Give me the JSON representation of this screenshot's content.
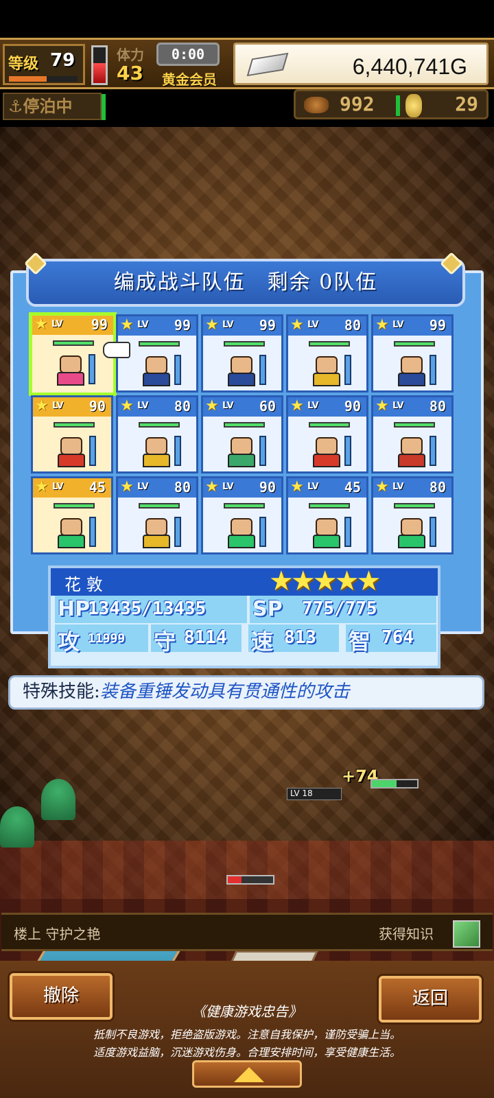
{
  "hud": {
    "level_label": "等级",
    "level": "79",
    "stamina_label": "体力",
    "stamina": "43",
    "timer": "0:00",
    "membership": "黄金会员",
    "gold": "6,440,741G",
    "dock_status": "停泊中",
    "resource_1": "992",
    "resource_2": "29"
  },
  "panel": {
    "title": "编成战斗队伍　剩余 0队伍",
    "lv_label": "LV",
    "cards": [
      {
        "lv": "99",
        "hdr": "gold",
        "body": "#e84a8a"
      },
      {
        "lv": "99",
        "hdr": "blue",
        "body": "#2a4a9a"
      },
      {
        "lv": "99",
        "hdr": "blue",
        "body": "#2a4a9a"
      },
      {
        "lv": "80",
        "hdr": "blue",
        "body": "#e6b82a"
      },
      {
        "lv": "99",
        "hdr": "blue",
        "body": "#2a4a9a"
      },
      {
        "lv": "90",
        "hdr": "gold",
        "body": "#d83a2a"
      },
      {
        "lv": "80",
        "hdr": "blue",
        "body": "#e6b82a"
      },
      {
        "lv": "60",
        "hdr": "blue",
        "body": "#3aa86a"
      },
      {
        "lv": "90",
        "hdr": "blue",
        "body": "#d83a2a"
      },
      {
        "lv": "80",
        "hdr": "blue",
        "body": "#c83a2a"
      },
      {
        "lv": "45",
        "hdr": "gold",
        "body": "#2ac46a"
      },
      {
        "lv": "80",
        "hdr": "blue",
        "body": "#e6b82a"
      },
      {
        "lv": "90",
        "hdr": "blue",
        "body": "#2ac46a"
      },
      {
        "lv": "45",
        "hdr": "blue",
        "body": "#2ac46a"
      },
      {
        "lv": "80",
        "hdr": "blue",
        "body": "#2ac46a"
      }
    ]
  },
  "stats": {
    "name": "花 敦",
    "stars": "★★★★★",
    "hp_label": "HP",
    "hp": "13435/13435",
    "sp_label": "SP",
    "sp": "775/775",
    "atk_label": "攻",
    "atk": "11999",
    "def_label": "守",
    "def": "8114",
    "spd_label": "速",
    "spd": "813",
    "int_label": "智",
    "int": "764"
  },
  "skill": {
    "label": "特殊技能:",
    "text": "装备重锤发动具有贯通性的攻击"
  },
  "info": {
    "left": "楼上 守护之艳",
    "right": "获得知识"
  },
  "buttons": {
    "remove": "撤除",
    "back": "返回"
  },
  "notice": {
    "title": "《健康游戏忠告》",
    "line1": "抵制不良游戏，拒绝盗版游戏。注意自我保护，谨防受骗上当。",
    "line2": "适度游戏益脑，沉迷游戏伤身。合理安排时间，享受健康生活。"
  },
  "scene": {
    "float_text": "+74",
    "lv_tag": "LV 18"
  },
  "colors": {
    "panel_blue": "#3b79d6",
    "selected_border": "#a6ff2a",
    "hp_green": "#52e06a",
    "gold_text": "#ffd24a"
  }
}
